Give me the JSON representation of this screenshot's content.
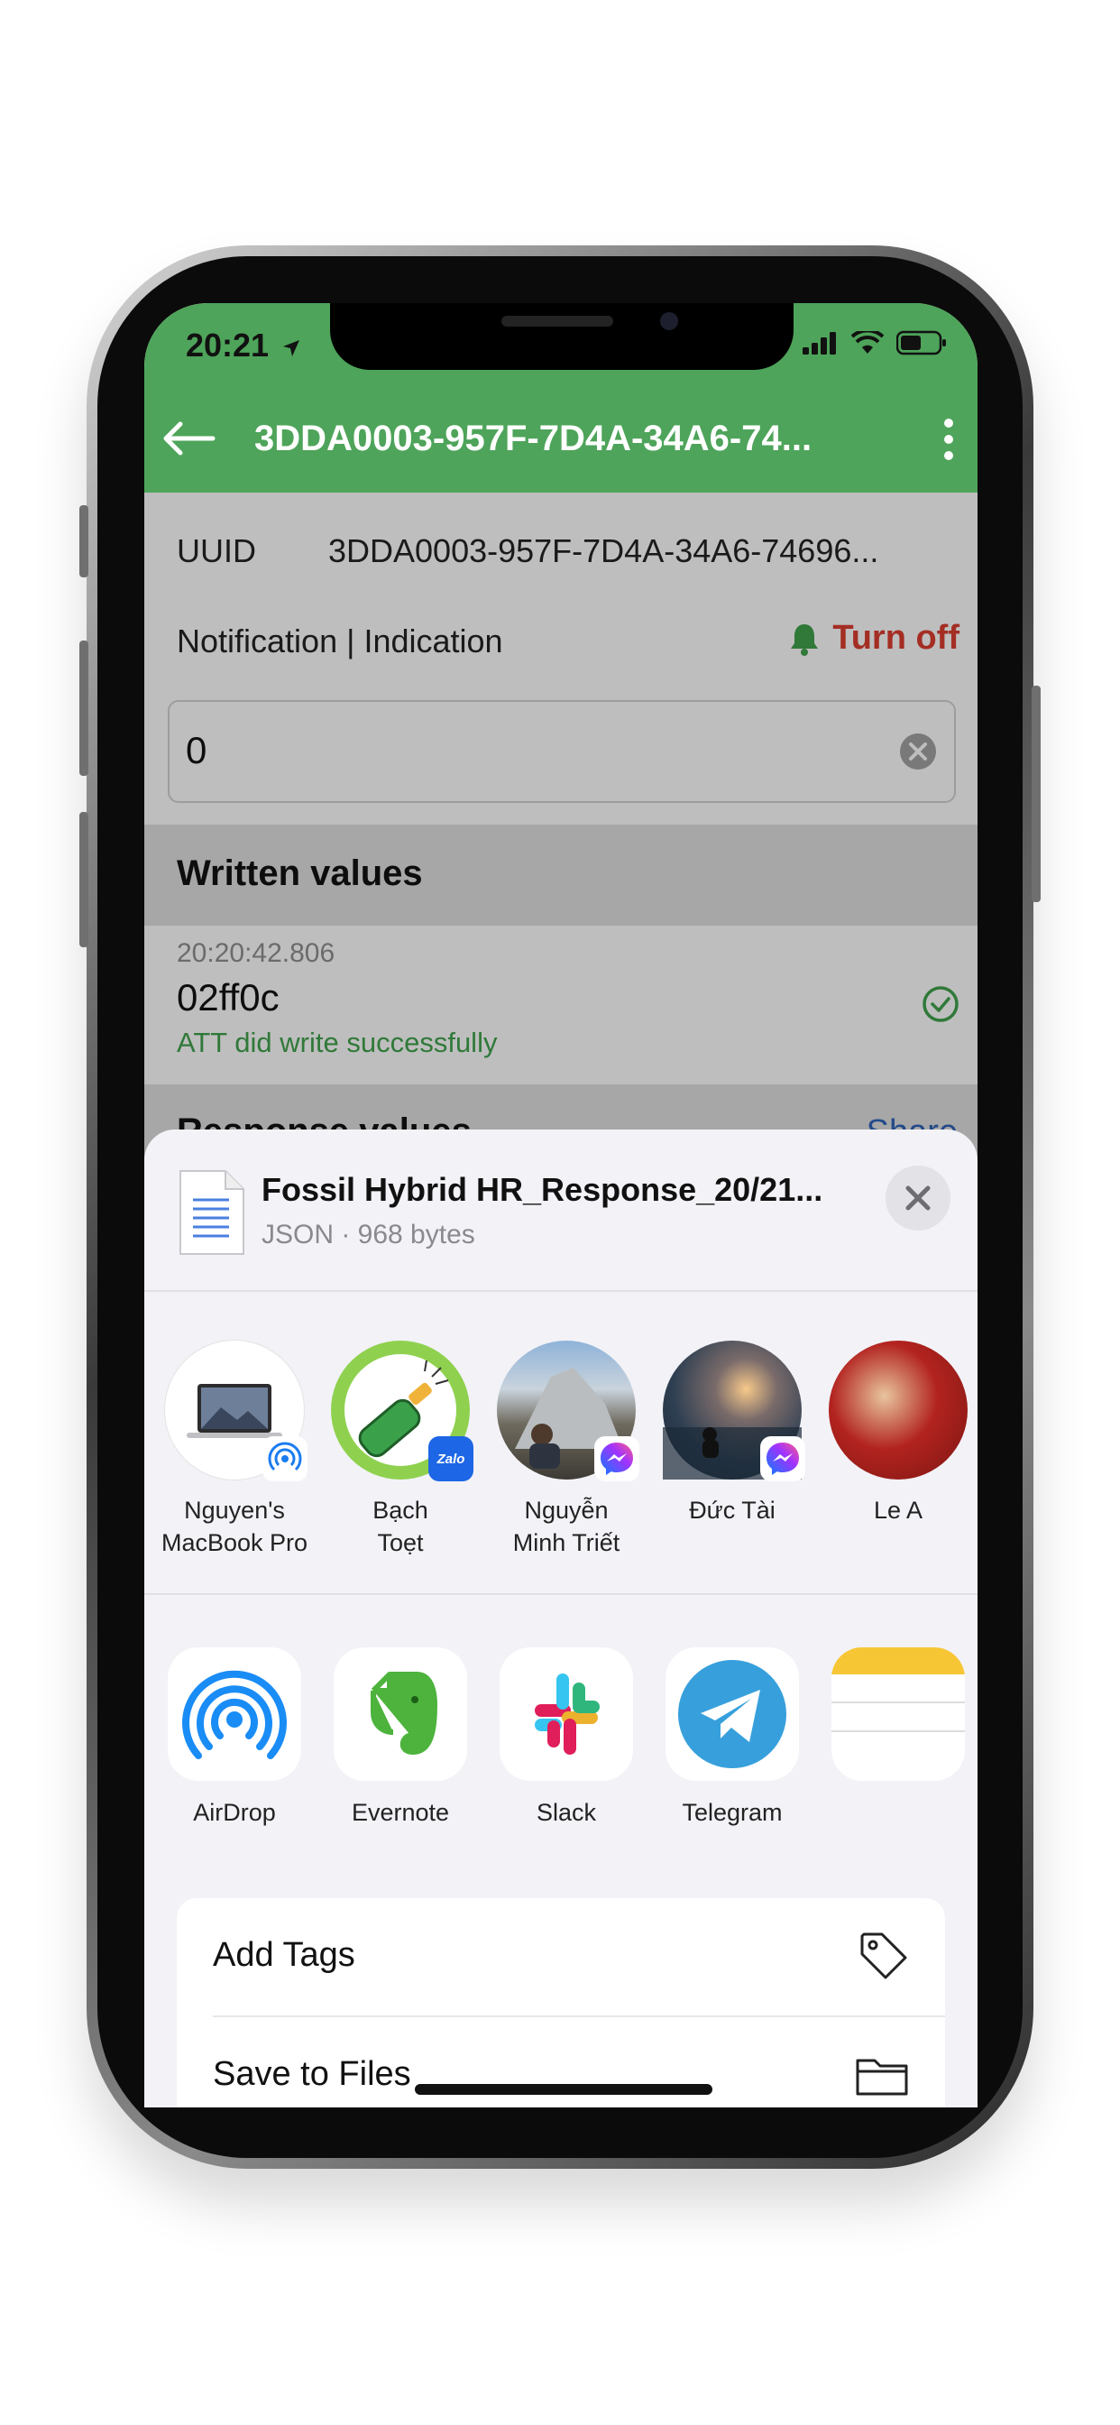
{
  "status_bar": {
    "time": "20:21"
  },
  "nav": {
    "title": "3DDA0003-957F-7D4A-34A6-74..."
  },
  "characteristic": {
    "uuid_label": "UUID",
    "uuid_value": "3DDA0003-957F-7D4A-34A6-74696...",
    "notification_label": "Notification | Indication",
    "turn_off_label": "Turn off",
    "input_value": "0"
  },
  "written": {
    "section_title": "Written values",
    "timestamp": "20:20:42.806",
    "value": "02ff0c",
    "status": "ATT did write successfully"
  },
  "response": {
    "section_title": "Response values",
    "share_label": "Share"
  },
  "share_sheet": {
    "file_name": "Fossil Hybrid HR_Response_20/21...",
    "file_meta": "JSON · 968 bytes",
    "people": [
      {
        "name_line1": "Nguyen's",
        "name_line2": "MacBook Pro",
        "badge": "airdrop-badge"
      },
      {
        "name_line1": "Bạch",
        "name_line2": "Toẹt",
        "badge": "zalo-badge",
        "badge_text": "Zalo"
      },
      {
        "name_line1": "Nguyễn",
        "name_line2": "Minh Triết",
        "badge": "messenger-badge"
      },
      {
        "name_line1": "Đức Tài",
        "name_line2": "",
        "badge": "messenger-badge"
      },
      {
        "name_line1": "Le A",
        "name_line2": "",
        "badge": ""
      }
    ],
    "apps": [
      {
        "label": "AirDrop",
        "icon": "airdrop-icon"
      },
      {
        "label": "Evernote",
        "icon": "evernote-icon"
      },
      {
        "label": "Slack",
        "icon": "slack-icon"
      },
      {
        "label": "Telegram",
        "icon": "telegram-icon"
      }
    ],
    "actions": [
      {
        "label": "Add Tags",
        "icon": "tag-icon"
      },
      {
        "label": "Save to Files",
        "icon": "folder-icon"
      }
    ]
  },
  "colors": {
    "header_green": "#4ea45a",
    "turn_off_red": "#d23b2f",
    "success_green": "#3e9b4a"
  }
}
